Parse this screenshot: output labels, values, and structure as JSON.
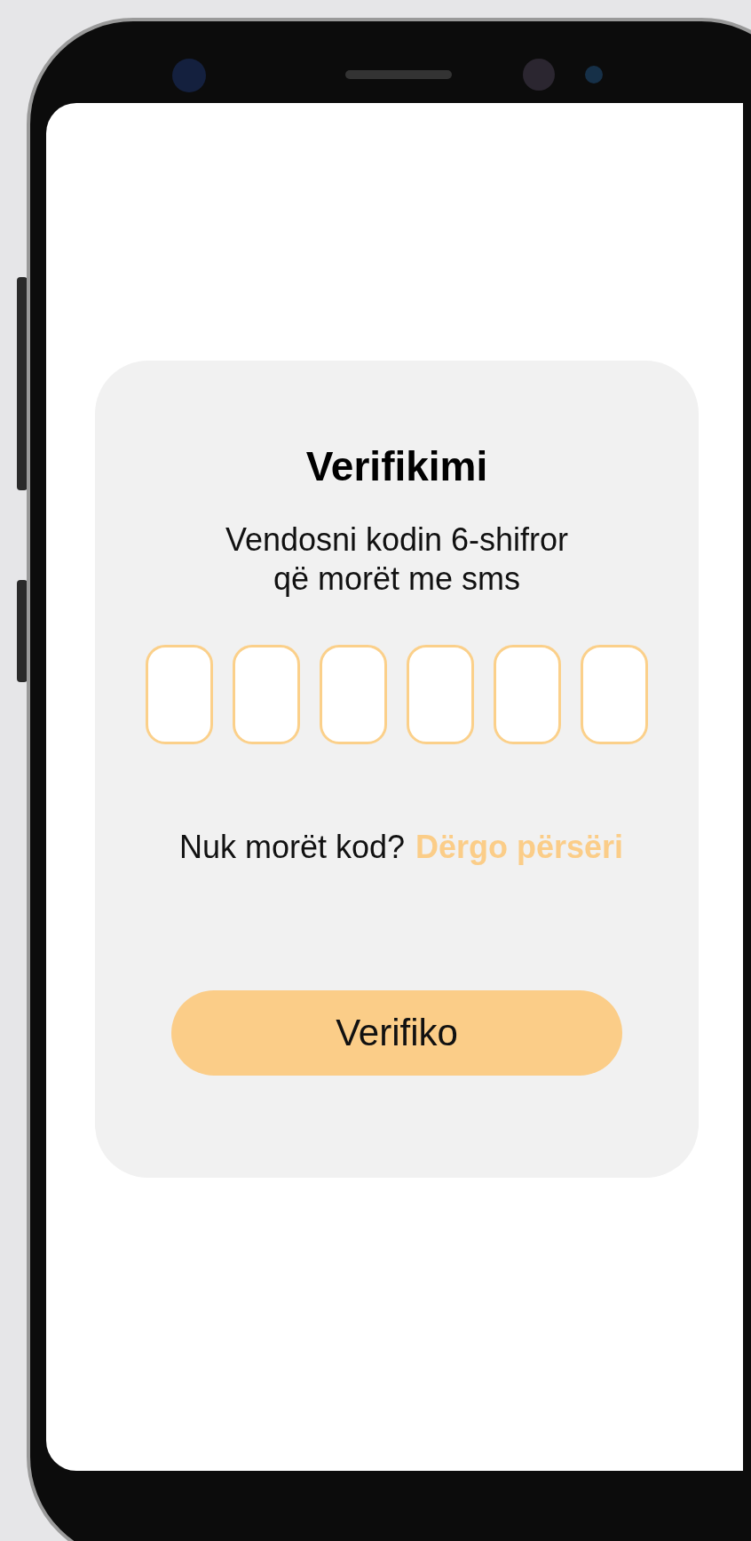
{
  "title": "Verifikimi",
  "subtitle": "Vendosni kodin 6-shifror\nqë morët me sms",
  "code_fields": [
    {
      "filled": false
    },
    {
      "filled": false
    },
    {
      "filled": false
    },
    {
      "filled": false
    },
    {
      "filled": false
    },
    {
      "filled": false
    }
  ],
  "resend": {
    "prompt": "Nuk morët kod?",
    "link": "Dërgo përsëri"
  },
  "verify_button": "Verifiko"
}
